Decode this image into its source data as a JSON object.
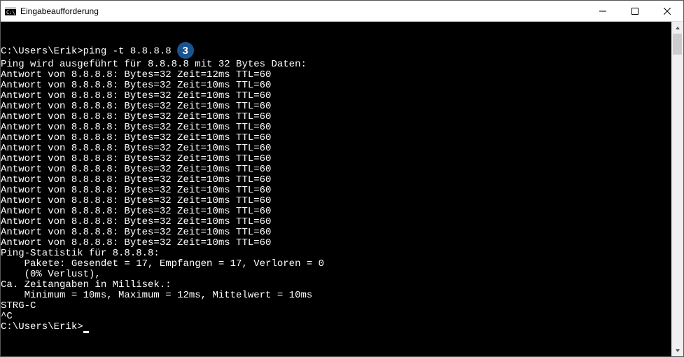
{
  "window": {
    "title": "Eingabeaufforderung"
  },
  "badge": {
    "value": "3",
    "color": "#1a5490"
  },
  "console": {
    "prompt1": "C:\\Users\\Erik>",
    "cmd": "ping -t 8.8.8.8",
    "blank": "",
    "header": "Ping wird ausgeführt für 8.8.8.8 mit 32 Bytes Daten:",
    "replies": [
      "Antwort von 8.8.8.8: Bytes=32 Zeit=12ms TTL=60",
      "Antwort von 8.8.8.8: Bytes=32 Zeit=10ms TTL=60",
      "Antwort von 8.8.8.8: Bytes=32 Zeit=10ms TTL=60",
      "Antwort von 8.8.8.8: Bytes=32 Zeit=10ms TTL=60",
      "Antwort von 8.8.8.8: Bytes=32 Zeit=10ms TTL=60",
      "Antwort von 8.8.8.8: Bytes=32 Zeit=10ms TTL=60",
      "Antwort von 8.8.8.8: Bytes=32 Zeit=10ms TTL=60",
      "Antwort von 8.8.8.8: Bytes=32 Zeit=10ms TTL=60",
      "Antwort von 8.8.8.8: Bytes=32 Zeit=10ms TTL=60",
      "Antwort von 8.8.8.8: Bytes=32 Zeit=10ms TTL=60",
      "Antwort von 8.8.8.8: Bytes=32 Zeit=10ms TTL=60",
      "Antwort von 8.8.8.8: Bytes=32 Zeit=10ms TTL=60",
      "Antwort von 8.8.8.8: Bytes=32 Zeit=10ms TTL=60",
      "Antwort von 8.8.8.8: Bytes=32 Zeit=10ms TTL=60",
      "Antwort von 8.8.8.8: Bytes=32 Zeit=10ms TTL=60",
      "Antwort von 8.8.8.8: Bytes=32 Zeit=10ms TTL=60",
      "Antwort von 8.8.8.8: Bytes=32 Zeit=10ms TTL=60"
    ],
    "stats1": "Ping-Statistik für 8.8.8.8:",
    "stats2": "    Pakete: Gesendet = 17, Empfangen = 17, Verloren = 0",
    "stats3": "    (0% Verlust),",
    "stats4": "Ca. Zeitangaben in Millisek.:",
    "stats5": "    Minimum = 10ms, Maximum = 12ms, Mittelwert = 10ms",
    "strgc": "STRG-C",
    "caretc": "^C",
    "prompt2": "C:\\Users\\Erik>"
  }
}
